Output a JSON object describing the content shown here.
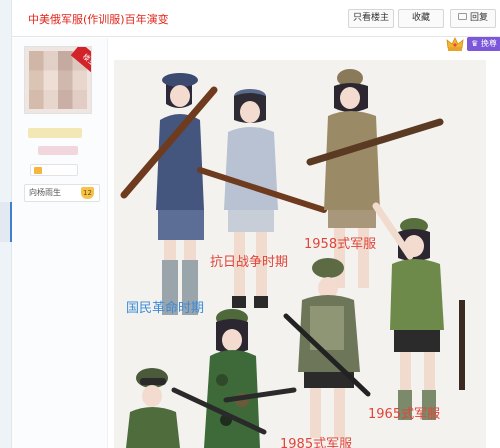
{
  "header": {
    "thread_title": "中美俄军服(作训服)百年演变",
    "only_op_label": "只看楼主",
    "favorite_label": "收藏",
    "reply_label": "回复",
    "vip_label": "挽尊"
  },
  "user": {
    "ribbon_label": "楼主",
    "fan_name": "向杨雨生",
    "fan_level": "12"
  },
  "post_image": {
    "annotations": [
      {
        "text": "1958式军服",
        "color": "#e0453a"
      },
      {
        "text": "抗日战争时期",
        "color": "#e0453a"
      },
      {
        "text": "国民革命时期",
        "color": "#3a8bd8"
      },
      {
        "text": "1965式军服",
        "color": "#e0453a"
      },
      {
        "text": "1985式军服",
        "color": "#e0453a"
      }
    ]
  },
  "colors": {
    "title_red": "#e1251b",
    "ribbon_red": "#d2232a",
    "vip_purple": "#7b57d9",
    "accent_blue": "#3f7fd0"
  }
}
